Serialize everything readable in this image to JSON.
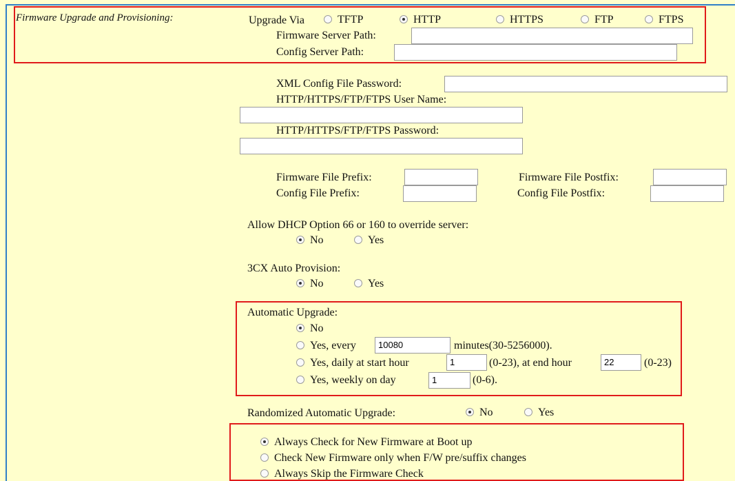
{
  "section_label": "Firmware Upgrade and Provisioning:",
  "upgrade_via": {
    "label": "Upgrade Via",
    "options": [
      "TFTP",
      "HTTP",
      "HTTPS",
      "FTP",
      "FTPS"
    ],
    "selected": "HTTP"
  },
  "firmware_server_path_label": "Firmware Server Path:",
  "firmware_server_path_value": "",
  "config_server_path_label": "Config Server Path:",
  "config_server_path_value": "",
  "xml_config_password_label": "XML Config File Password:",
  "user_name_label": "HTTP/HTTPS/FTP/FTPS User Name:",
  "password_label": "HTTP/HTTPS/FTP/FTPS Password:",
  "firmware_file_prefix_label": "Firmware File Prefix:",
  "firmware_file_postfix_label": "Firmware File Postfix:",
  "config_file_prefix_label": "Config File Prefix:",
  "config_file_postfix_label": "Config File Postfix:",
  "dhcp_override": {
    "label": "Allow DHCP Option 66 or 160 to override server:",
    "options": [
      "No",
      "Yes"
    ],
    "selected": "No"
  },
  "auto_provision": {
    "label": "3CX Auto Provision:",
    "options": [
      "No",
      "Yes"
    ],
    "selected": "No"
  },
  "automatic_upgrade": {
    "label": "Automatic Upgrade:",
    "opt_no": "No",
    "opt_every_prefix": "Yes, every",
    "every_value": "10080",
    "every_suffix": "minutes(30-5256000).",
    "opt_daily_prefix": "Yes, daily at start hour",
    "start_hour_value": "1",
    "daily_mid": "(0-23), at end hour",
    "end_hour_value": "22",
    "daily_suffix": "(0-23)",
    "opt_weekly_prefix": "Yes, weekly on day",
    "weekly_value": "1",
    "weekly_suffix": "(0-6).",
    "selected": "No"
  },
  "randomized_upgrade": {
    "label": "Randomized Automatic Upgrade:",
    "options": [
      "No",
      "Yes"
    ],
    "selected": "No"
  },
  "firmware_check": {
    "options": [
      "Always Check for New Firmware at Boot up",
      "Check New Firmware only when F/W pre/suffix changes",
      "Always Skip the Firmware Check"
    ],
    "selected": "Always Check for New Firmware at Boot up"
  }
}
